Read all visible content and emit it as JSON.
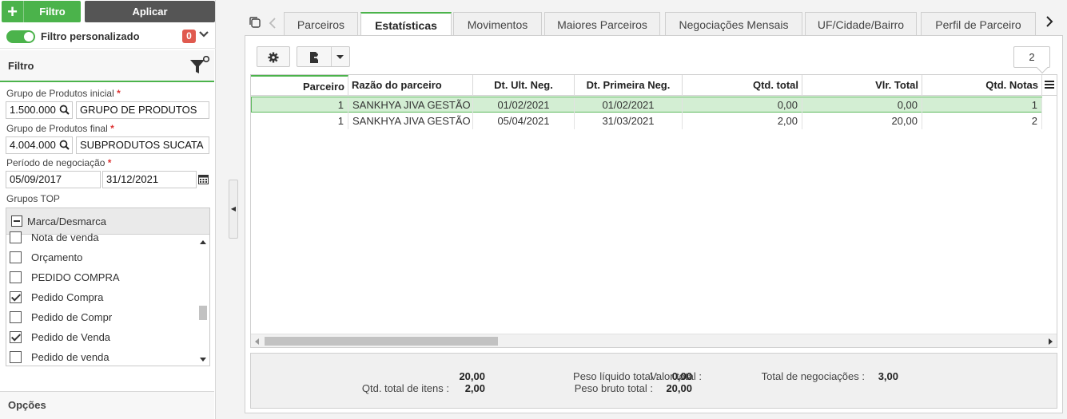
{
  "toolbar": {
    "filtro_label": "Filtro",
    "aplicar_label": "Aplicar"
  },
  "filter_personalizado": {
    "label": "Filtro personalizado",
    "badge": "0",
    "enabled": true
  },
  "filtro_panel": {
    "title": "Filtro",
    "grupo_inicial": {
      "label": "Grupo de Produtos inicial",
      "code": "1.500.000",
      "name": "GRUPO DE PRODUTOS"
    },
    "grupo_final": {
      "label": "Grupo de Produtos final",
      "code": "4.004.000",
      "name": "SUBPRODUTOS SUCATA"
    },
    "periodo": {
      "label": "Período de negociação",
      "start": "05/09/2017",
      "end": "31/12/2021"
    },
    "required_mark": "*",
    "grupos_top": {
      "label": "Grupos TOP",
      "marca_desmarca": "Marca/Desmarca",
      "items": [
        {
          "label": "Nota de venda",
          "checked": false
        },
        {
          "label": "Orçamento",
          "checked": false
        },
        {
          "label": "PEDIDO COMPRA",
          "checked": false
        },
        {
          "label": "Pedido Compra",
          "checked": true
        },
        {
          "label": "Pedido de Compr",
          "checked": false
        },
        {
          "label": "Pedido de Venda",
          "checked": true
        },
        {
          "label": "Pedido de venda",
          "checked": false
        }
      ]
    },
    "opcoes_label": "Opções"
  },
  "tabs": [
    {
      "label": "Parceiros",
      "active": false
    },
    {
      "label": "Estatísticas",
      "active": true
    },
    {
      "label": "Movimentos",
      "active": false
    },
    {
      "label": "Maiores Parceiros",
      "active": false
    },
    {
      "label": "Negociações Mensais",
      "active": false
    },
    {
      "label": "UF/Cidade/Bairro",
      "active": false
    },
    {
      "label": "Perfil de Parceiro",
      "active": false
    }
  ],
  "record_count": "2",
  "grid": {
    "columns": [
      "Parceiro",
      "Razão do parceiro",
      "Dt. Ult. Neg.",
      "Dt. Primeira Neg.",
      "Qtd. total",
      "Vlr. Total",
      "Qtd. Notas"
    ],
    "rows": [
      [
        "1",
        "SANKHYA JIVA GESTÃO",
        "01/02/2021",
        "01/02/2021",
        "0,00",
        "0,00",
        "1"
      ],
      [
        "1",
        "SANKHYA JIVA GESTÃO",
        "05/04/2021",
        "31/03/2021",
        "2,00",
        "20,00",
        "2"
      ]
    ]
  },
  "footer": {
    "valor_total_label": "Valor total :",
    "valor_total": "20,00",
    "qtd_itens_label": "Qtd. total de itens :",
    "qtd_itens": "2,00",
    "peso_liquido_label": "Peso líquido total :",
    "peso_liquido": "0,00",
    "peso_bruto_label": "Peso bruto total :",
    "peso_bruto": "20,00",
    "total_neg_label": "Total de negociações :",
    "total_neg": "3,00"
  },
  "colors": {
    "accent": "#4bb34b",
    "badge": "#e05a4f",
    "selected_row": "#d3eed3"
  }
}
